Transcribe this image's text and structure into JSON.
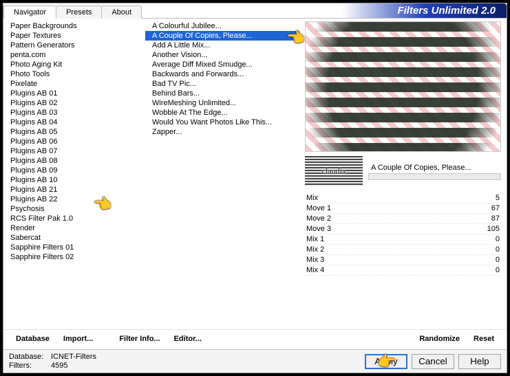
{
  "app_title": "Filters Unlimited 2.0",
  "tabs": {
    "navigator": "Navigator",
    "presets": "Presets",
    "about": "About"
  },
  "categories": [
    "Paper Backgrounds",
    "Paper Textures",
    "Pattern Generators",
    "penta.com",
    "Photo Aging Kit",
    "Photo Tools",
    "Pixelate",
    "Plugins AB 01",
    "Plugins AB 02",
    "Plugins AB 03",
    "Plugins AB 04",
    "Plugins AB 05",
    "Plugins AB 06",
    "Plugins AB 07",
    "Plugins AB 08",
    "Plugins AB 09",
    "Plugins AB 10",
    "Plugins AB 21",
    "Plugins AB 22",
    "Psychosis",
    "RCS Filter Pak 1.0",
    "Render",
    "Sabercat",
    "Sapphire Filters 01",
    "Sapphire Filters 02"
  ],
  "filters": [
    "A Colourful Jubilee...",
    "A Couple Of Copies, Please...",
    "Add A Little Mix...",
    "Another Vision...",
    "Average Diff Mixed Smudge...",
    "Backwards and Forwards...",
    "Bad TV Pic...",
    "Behind Bars...",
    "WireMeshing Unlimited...",
    "Wobble At The Edge...",
    "Would You Want Photos Like This...",
    "Zapper..."
  ],
  "selected_filter_index": 1,
  "current_filter_label": "A Couple Of Copies, Please...",
  "logo_text": "claudia",
  "params": [
    {
      "name": "Mix",
      "value": "5"
    },
    {
      "name": "Move 1",
      "value": "67"
    },
    {
      "name": "Move 2",
      "value": "87"
    },
    {
      "name": "Move 3",
      "value": "105"
    },
    {
      "name": "Mix 1",
      "value": "0"
    },
    {
      "name": "Mix 2",
      "value": "0"
    },
    {
      "name": "Mix 3",
      "value": "0"
    },
    {
      "name": "Mix 4",
      "value": "0"
    }
  ],
  "toolbar": {
    "database": "Database",
    "import": "Import...",
    "filter_info": "Filter Info...",
    "editor": "Editor...",
    "randomize": "Randomize",
    "reset": "Reset"
  },
  "status": {
    "db_label": "Database:",
    "db_value": "ICNET-Filters",
    "filters_label": "Filters:",
    "filters_value": "4595"
  },
  "buttons": {
    "apply": "Apply",
    "cancel": "Cancel",
    "help": "Help"
  }
}
